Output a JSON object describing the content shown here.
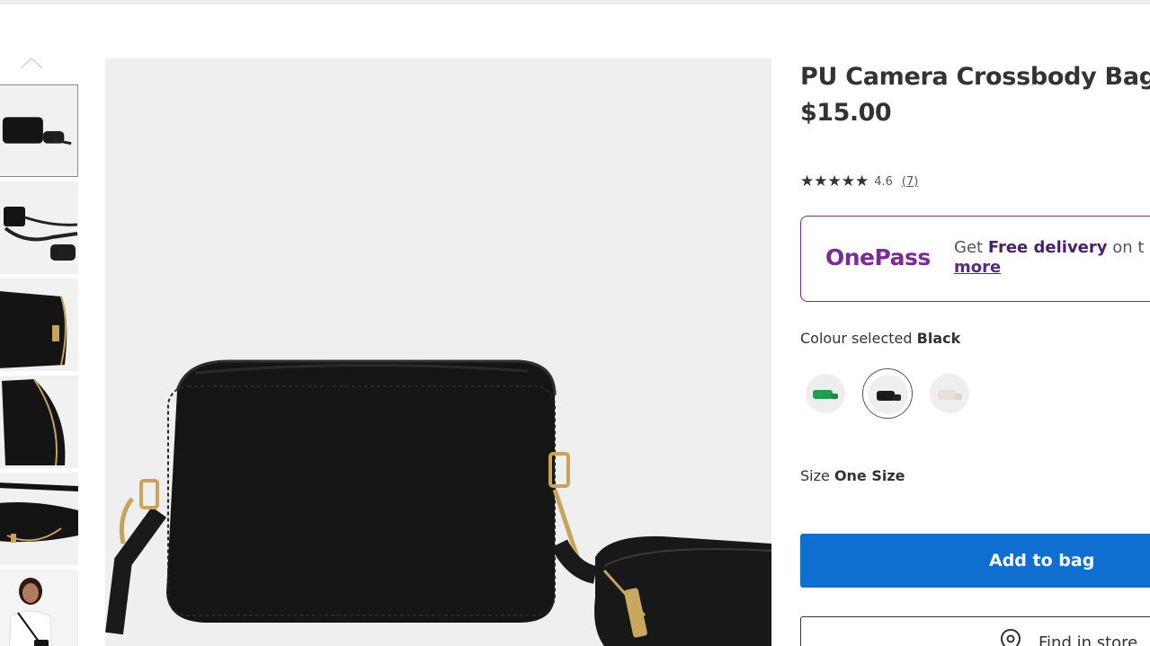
{
  "product": {
    "title": "PU Camera Crossbody Bag",
    "price": "$15.00",
    "rating": {
      "stars": "★★★★★",
      "value": "4.6",
      "count": "(7)"
    }
  },
  "onepass": {
    "logo": "OnePass",
    "text_prefix": "Get ",
    "text_bold": "Free delivery",
    "text_suffix": " on t",
    "more_link": "more",
    "border_color": "#6b2e87"
  },
  "colour": {
    "label": "Colour selected",
    "selected": "Black",
    "options": [
      {
        "name": "Green",
        "color": "#1f9e4b"
      },
      {
        "name": "Black",
        "color": "#1a1a1a"
      },
      {
        "name": "Cream",
        "color": "#e9e4dc"
      }
    ]
  },
  "size": {
    "label": "Size",
    "selected": "One Size"
  },
  "actions": {
    "add_to_bag": "Add to bag",
    "find_in_store": "Find in store",
    "accent_color": "#0f6fd1"
  },
  "gallery": {
    "thumbnails": [
      "bag-front",
      "bag-with-strap",
      "bag-side-zip",
      "bag-angle",
      "bag-detail",
      "model-wearing"
    ],
    "selected_index": 0,
    "up_arrow_icon": "chevron-up-icon"
  }
}
